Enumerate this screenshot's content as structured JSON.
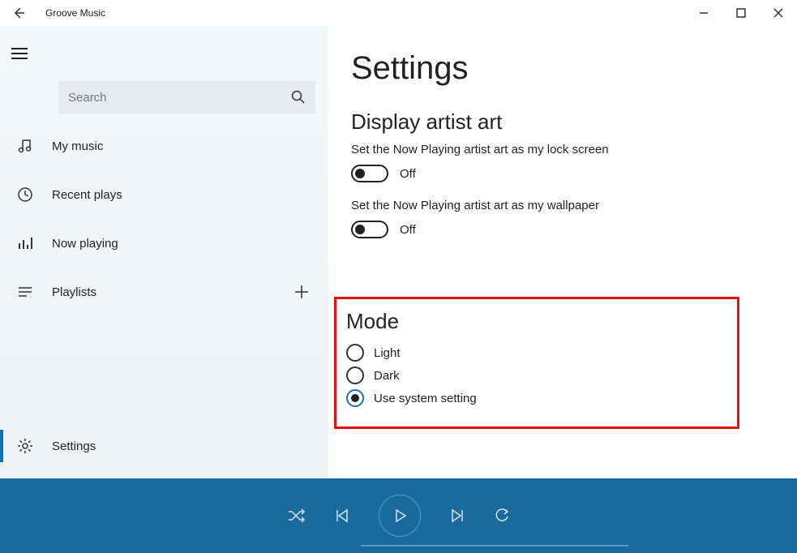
{
  "titlebar": {
    "title": "Groove Music"
  },
  "search": {
    "placeholder": "Search"
  },
  "nav": {
    "my_music": "My music",
    "recent": "Recent plays",
    "now_playing": "Now playing",
    "playlists": "Playlists",
    "settings": "Settings"
  },
  "settings": {
    "heading": "Settings",
    "artist_art": {
      "heading": "Display artist art",
      "lockscreen_label": "Set the Now Playing artist art as my lock screen",
      "lockscreen_state": "Off",
      "wallpaper_label": "Set the Now Playing artist art as my wallpaper",
      "wallpaper_state": "Off"
    },
    "mode": {
      "heading": "Mode",
      "light": "Light",
      "dark": "Dark",
      "system": "Use system setting"
    }
  }
}
